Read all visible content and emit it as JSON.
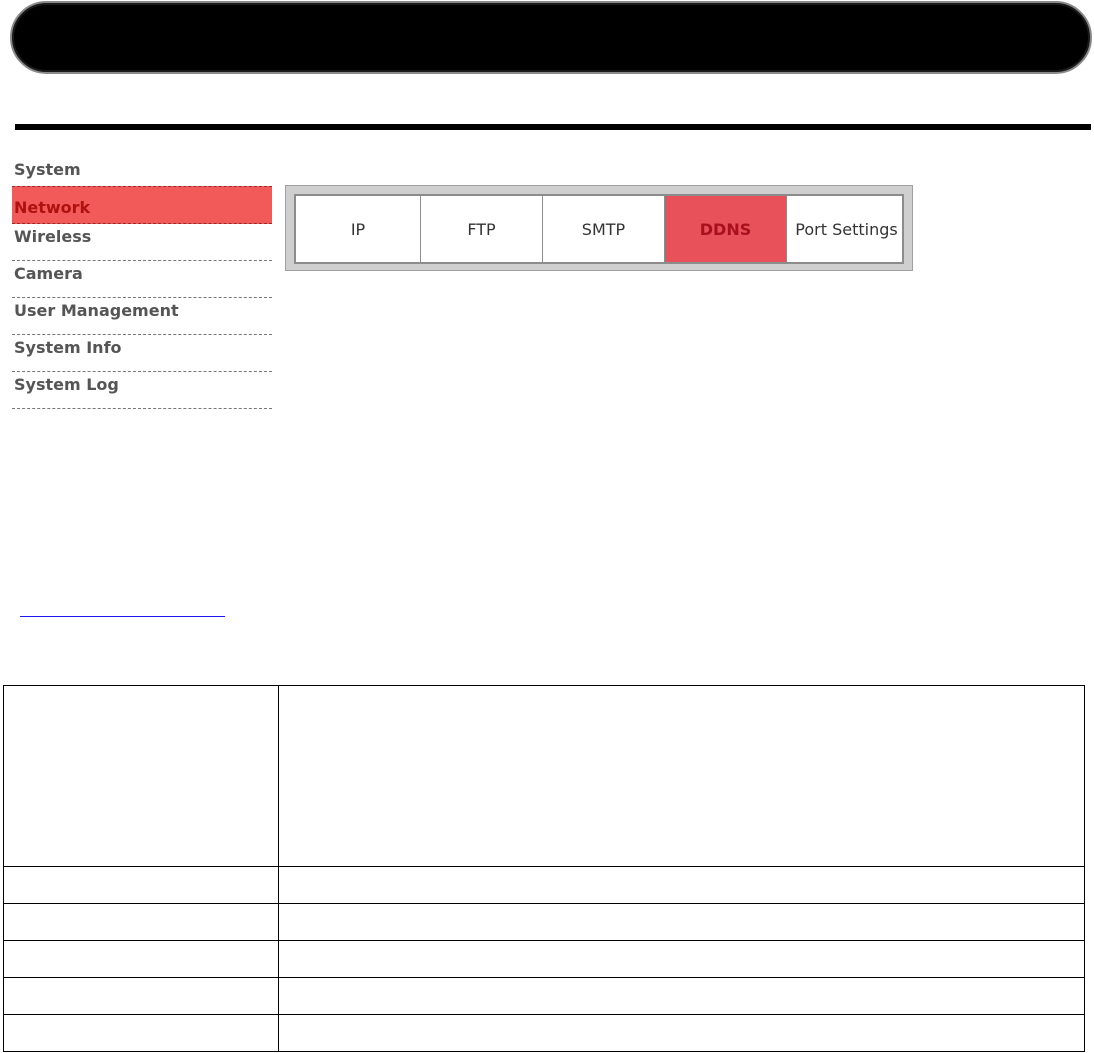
{
  "sidebar": {
    "items": [
      {
        "label": "System"
      },
      {
        "label": "Network"
      },
      {
        "label": "Wireless"
      },
      {
        "label": "Camera"
      },
      {
        "label": "User Management"
      },
      {
        "label": "System Info"
      },
      {
        "label": "System Log"
      }
    ],
    "active_index": 1
  },
  "tabs": [
    {
      "label": "IP"
    },
    {
      "label": "FTP"
    },
    {
      "label": "SMTP"
    },
    {
      "label": "DDNS"
    },
    {
      "label": "Port Settings"
    }
  ],
  "active_tab_index": 3,
  "link": {
    "label": ""
  },
  "table": {
    "rows": [
      {
        "col1": "",
        "col2": ""
      },
      {
        "col1": "",
        "col2": ""
      },
      {
        "col1": "",
        "col2": ""
      },
      {
        "col1": "",
        "col2": ""
      },
      {
        "col1": "",
        "col2": ""
      },
      {
        "col1": "",
        "col2": ""
      }
    ]
  },
  "colors": {
    "active_highlight": "#f25a5a",
    "active_text": "#b01010",
    "sidebar_text": "#555555",
    "link": "#1a1aee"
  }
}
